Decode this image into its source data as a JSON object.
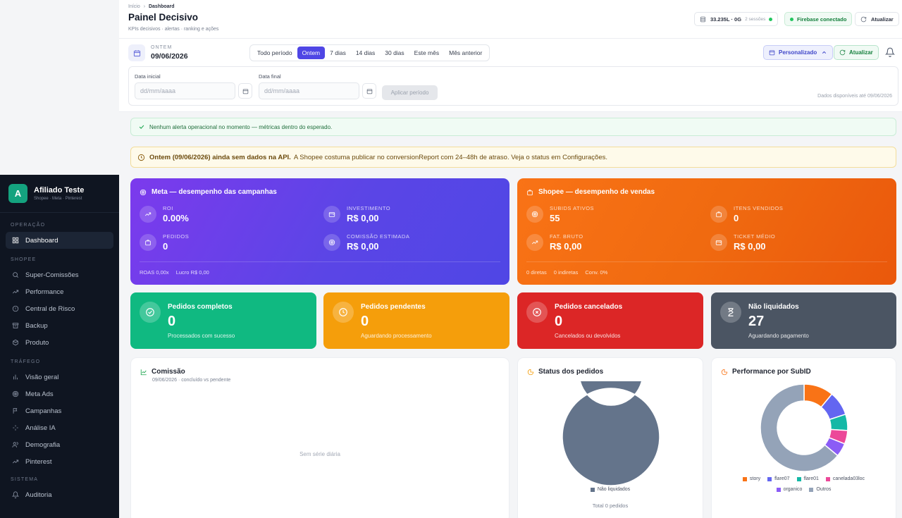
{
  "breadcrumb": {
    "home": "Início",
    "sep": "›",
    "current": "Dashboard"
  },
  "header": {
    "title": "Painel Decisivo",
    "subtitle": "KPIs decisivos · alertas · ranking e ações",
    "storage": {
      "value": "33.235L · 0G",
      "sessions": "2 sessões"
    },
    "firebase": "Firebase conectado",
    "refresh": "Atualizar"
  },
  "filter": {
    "date_label": "ONTEM",
    "date_value": "09/06/2026",
    "periods": [
      "Todo período",
      "Ontem",
      "7 dias",
      "14 dias",
      "30 dias",
      "Este mês",
      "Mês anterior"
    ],
    "selected_period": "Ontem",
    "custom": "Personalizado",
    "refresh": "Atualizar",
    "start_label": "Data inicial",
    "end_label": "Data final",
    "start_placeholder": "dd/mm/aaaa",
    "end_placeholder": "dd/mm/aaaa",
    "apply": "Aplicar período",
    "available": "Dados disponíveis até 09/06/2026"
  },
  "alerts": {
    "ok": "Nenhum alerta operacional no momento — métricas dentro do esperado.",
    "warn_bold": "Ontem (09/06/2026) ainda sem dados na API.",
    "warn_text": "A Shopee costuma publicar no conversionReport com 24–48h de atraso. Veja o status em Configurações."
  },
  "meta_card": {
    "title": "Meta — desempenho das campanhas",
    "kpis": [
      {
        "label": "ROI",
        "value": "0.00%",
        "icon": "trend-up-icon"
      },
      {
        "label": "INVESTIMENTO",
        "value": "R$ 0,00",
        "icon": "wallet-icon"
      },
      {
        "label": "PEDIDOS",
        "value": "0",
        "icon": "bag-icon"
      },
      {
        "label": "COMISSÃO ESTIMADA",
        "value": "R$ 0,00",
        "icon": "target-icon"
      }
    ],
    "footer": [
      "ROAS 0,00x",
      "Lucro R$ 0,00"
    ]
  },
  "shopee_card": {
    "title": "Shopee — desempenho de vendas",
    "kpis": [
      {
        "label": "SUBIDS ATIVOS",
        "value": "55",
        "icon": "target-icon"
      },
      {
        "label": "ITENS VENDIDOS",
        "value": "0",
        "icon": "bag-icon"
      },
      {
        "label": "FAT. BRUTO",
        "value": "R$ 0,00",
        "icon": "trend-up-icon"
      },
      {
        "label": "TICKET MÉDIO",
        "value": "R$ 0,00",
        "icon": "wallet-icon"
      }
    ],
    "footer": [
      "0 diretas",
      "0 indiretas",
      "Conv. 0%"
    ]
  },
  "status_cards": [
    {
      "title": "Pedidos completos",
      "value": "0",
      "sub": "Processados com sucesso",
      "color": "#10b981"
    },
    {
      "title": "Pedidos pendentes",
      "value": "0",
      "sub": "Aguardando processamento",
      "color": "#f59e0b"
    },
    {
      "title": "Pedidos cancelados",
      "value": "0",
      "sub": "Cancelados ou devolvidos",
      "color": "#dc2626"
    },
    {
      "title": "Não liquidados",
      "value": "27",
      "sub": "Aguardando pagamento",
      "color": "#4b5563"
    }
  ],
  "commission": {
    "title": "Comissão",
    "subtitle": "09/06/2026 · concluído vs pendente",
    "empty": "Sem série diária"
  },
  "orders_status": {
    "title": "Status dos pedidos",
    "total": "Total 0 pedidos"
  },
  "subid_perf": {
    "title": "Performance por SubID"
  },
  "chart_data": [
    {
      "type": "pie",
      "title": "Status dos pedidos",
      "categories": [
        "Não liquidados"
      ],
      "values": [
        100
      ],
      "colors": [
        "#64748b"
      ]
    },
    {
      "type": "pie",
      "title": "Performance por SubID",
      "categories": [
        "story",
        "flare07",
        "flare01",
        "canelada03loc",
        "organico",
        "Outros"
      ],
      "values": [
        11,
        9,
        6,
        5,
        5,
        64
      ],
      "colors": [
        "#f97316",
        "#6366f1",
        "#14b8a6",
        "#ec4899",
        "#8b5cf6",
        "#94a3b8"
      ]
    }
  ],
  "sidebar": {
    "brand": {
      "letter": "A",
      "name": "Afiliado Teste",
      "sub": "Shopee · Meta · Pinterest"
    },
    "sections": [
      {
        "title": "OPERAÇÃO",
        "items": [
          {
            "label": "Dashboard",
            "icon": "grid-icon",
            "active": true
          }
        ]
      },
      {
        "title": "SHOPEE",
        "items": [
          {
            "label": "Super-Comissões",
            "icon": "search-icon"
          },
          {
            "label": "Performance",
            "icon": "trend-up-icon"
          },
          {
            "label": "Central de Risco",
            "icon": "alert-circle-icon"
          },
          {
            "label": "Backup",
            "icon": "archive-icon"
          },
          {
            "label": "Produto",
            "icon": "package-icon"
          }
        ]
      },
      {
        "title": "TRÁFEGO",
        "items": [
          {
            "label": "Visão geral",
            "icon": "bar-chart-icon"
          },
          {
            "label": "Meta Ads",
            "icon": "target-icon"
          },
          {
            "label": "Campanhas",
            "icon": "flag-icon"
          },
          {
            "label": "Análise IA",
            "icon": "sparkle-icon"
          },
          {
            "label": "Demografia",
            "icon": "users-icon"
          },
          {
            "label": "Pinterest",
            "icon": "trend-up-icon"
          }
        ]
      },
      {
        "title": "SISTEMA",
        "items": [
          {
            "label": "Auditoria",
            "icon": "bell-icon"
          }
        ]
      }
    ]
  }
}
